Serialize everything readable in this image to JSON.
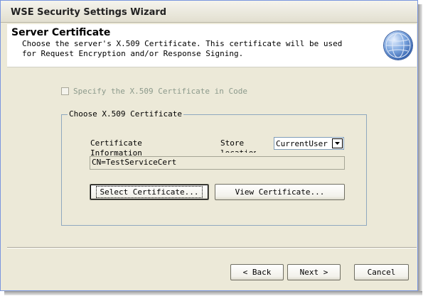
{
  "window": {
    "title": "WSE Security Settings Wizard"
  },
  "header": {
    "title": "Server Certificate",
    "description": "Choose the server's X.509 Certificate. This certificate will be used for Request Encryption and/or Response Signing.",
    "icon": "globe-icon"
  },
  "code_option": {
    "label": "Specify the X.509 Certificate in Code",
    "checked": false,
    "enabled": false
  },
  "group": {
    "legend": "Choose X.509 Certificate",
    "info_label": "Certificate Information",
    "store_label": "Store location",
    "store_value": "CurrentUser",
    "cert_value": "CN=TestServiceCert",
    "select_button": "Select Certificate...",
    "view_button": "View Certificate..."
  },
  "footer": {
    "back": "< Back",
    "next": "Next >",
    "cancel": "Cancel"
  },
  "colors": {
    "window_bg": "#ece9d8",
    "header_bg": "#ffffff",
    "disabled_text": "#8c9a8c",
    "group_border": "#8fa8bf"
  }
}
